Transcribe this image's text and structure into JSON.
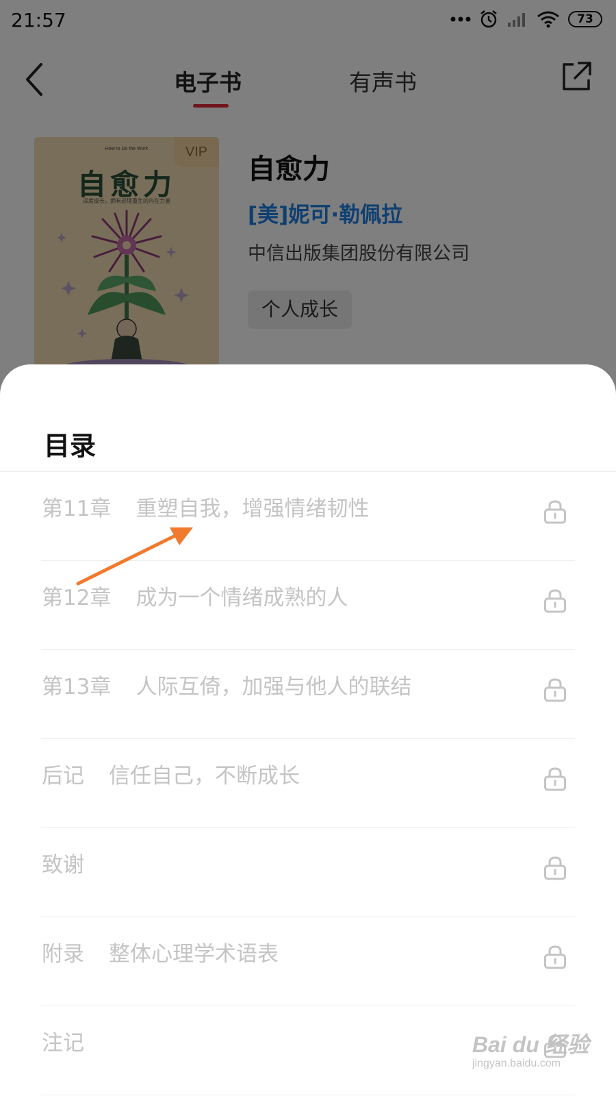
{
  "status_bar": {
    "time": "21:57",
    "battery": "73"
  },
  "nav": {
    "tabs": [
      {
        "label": "电子书",
        "active": true
      },
      {
        "label": "有声书",
        "active": false
      }
    ],
    "accent_color": "#e02a3a"
  },
  "book": {
    "cover_badge": "VIP",
    "cover_title": "自愈力",
    "cover_subtitle": "How to Do the Work",
    "cover_tagline": "深度成长，拥有逆境重生的内在力量",
    "title": "自愈力",
    "author": "[美]妮可·勒佩拉",
    "publisher": "中信出版集团股份有限公司",
    "tag": "个人成长",
    "author_color": "#1e7fe0"
  },
  "toc": {
    "title": "目录",
    "items": [
      {
        "prefix": "第11章",
        "name": "重塑自我，增强情绪韧性",
        "locked": true
      },
      {
        "prefix": "第12章",
        "name": "成为一个情绪成熟的人",
        "locked": true
      },
      {
        "prefix": "第13章",
        "name": "人际互倚，加强与他人的联结",
        "locked": true
      },
      {
        "prefix": "后记",
        "name": "信任自己，不断成长",
        "locked": true
      },
      {
        "prefix": "致谢",
        "name": "",
        "locked": true
      },
      {
        "prefix": "附录",
        "name": "整体心理学术语表",
        "locked": true
      },
      {
        "prefix": "注记",
        "name": "",
        "locked": true
      }
    ]
  },
  "watermark": {
    "main": "Bai du 经验",
    "sub": "jingyan.baidu.com"
  },
  "annotation_arrow_color": "#f07a2e"
}
